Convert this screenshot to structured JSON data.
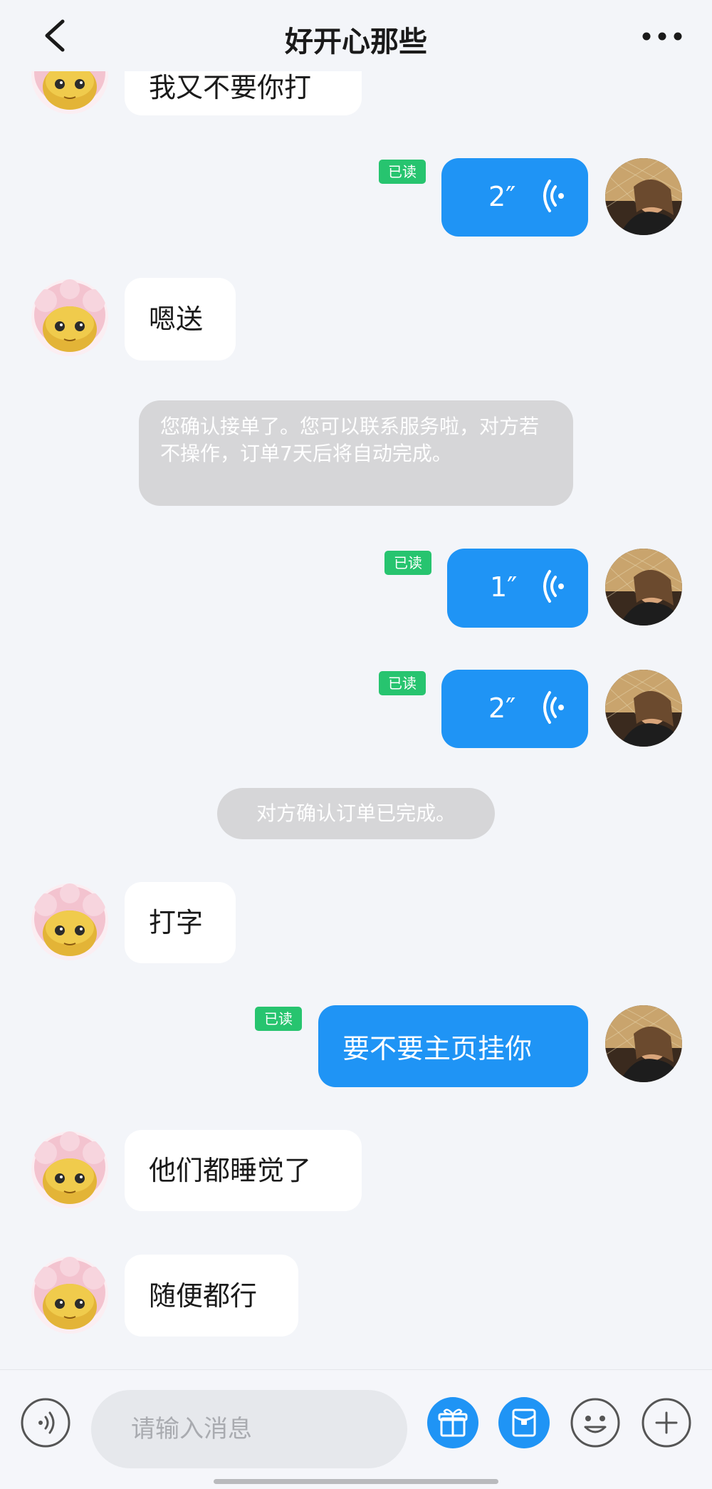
{
  "header": {
    "title": "好开心那些"
  },
  "messages": {
    "m0_partial": "我又不要你打",
    "m1_voice": "2″",
    "m2": "嗯送",
    "sys1": "您确认接单了。您可以联系服务啦，对方若不操作，订单7天后将自动完成。",
    "m3_voice": "1″",
    "m4_voice": "2″",
    "sys2": "对方确认订单已完成。",
    "m5": "打字",
    "m6": "要不要主页挂你",
    "m7": "他们都睡觉了",
    "m8": "随便都行"
  },
  "read_label": "已读",
  "composer": {
    "placeholder": "请输入消息"
  },
  "colors": {
    "accent": "#1f94f5",
    "read_badge": "#27c46f",
    "background": "#f3f5f9",
    "system_bubble": "#d6d6d8"
  },
  "icons": [
    "back-icon",
    "more-icon",
    "voice-wave-icon",
    "voice-toggle-icon",
    "gift-icon",
    "red-packet-icon",
    "emoji-icon",
    "plus-icon"
  ]
}
